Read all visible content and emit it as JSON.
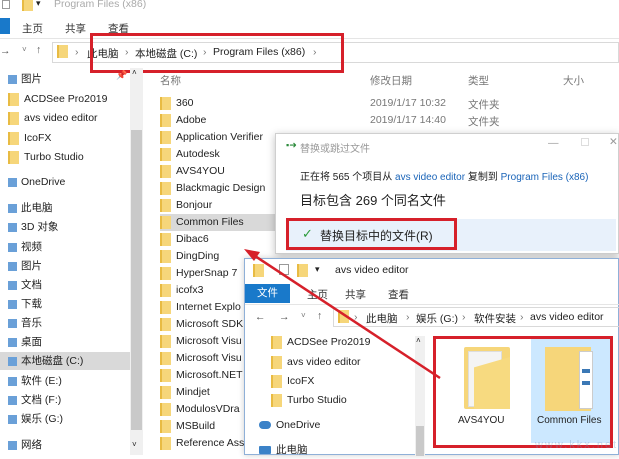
{
  "back_window": {
    "title": "Program Files (x86)",
    "ribbon_tabs": [
      "主页",
      "共享",
      "查看"
    ],
    "breadcrumb": [
      "此电脑",
      "本地磁盘 (C:)",
      "Program Files (x86)"
    ],
    "nav_items": [
      {
        "label": "图片",
        "quick": true
      },
      {
        "label": "ACDSee Pro2019",
        "quick": true
      },
      {
        "label": "avs video editor",
        "quick": true
      },
      {
        "label": "IcoFX",
        "quick": true
      },
      {
        "label": "Turbo Studio",
        "quick": true
      },
      {
        "label": "OneDrive"
      },
      {
        "label": "此电脑"
      },
      {
        "label": "3D 对象"
      },
      {
        "label": "视频"
      },
      {
        "label": "图片"
      },
      {
        "label": "文档"
      },
      {
        "label": "下载"
      },
      {
        "label": "音乐"
      },
      {
        "label": "桌面"
      },
      {
        "label": "本地磁盘 (C:)",
        "selected": true
      },
      {
        "label": "软件 (E:)"
      },
      {
        "label": "文档 (F:)"
      },
      {
        "label": "娱乐 (G:)"
      },
      {
        "label": "网络"
      }
    ],
    "columns": [
      "名称",
      "修改日期",
      "类型",
      "大小"
    ],
    "files": [
      {
        "name": "360",
        "date": "2019/1/17 10:32",
        "type": "文件夹"
      },
      {
        "name": "Adobe",
        "date": "2019/1/17 14:40",
        "type": "文件夹"
      },
      {
        "name": "Application Verifier"
      },
      {
        "name": "Autodesk"
      },
      {
        "name": "AVS4YOU"
      },
      {
        "name": "Blackmagic Design"
      },
      {
        "name": "Bonjour"
      },
      {
        "name": "Common Files",
        "selected": true
      },
      {
        "name": "Dibac6"
      },
      {
        "name": "DingDing"
      },
      {
        "name": "HyperSnap 7"
      },
      {
        "name": "icofx3"
      },
      {
        "name": "Internet Explo"
      },
      {
        "name": "Microsoft SDK"
      },
      {
        "name": "Microsoft Visu"
      },
      {
        "name": "Microsoft Visu"
      },
      {
        "name": "Microsoft.NET"
      },
      {
        "name": "Mindjet"
      },
      {
        "name": "ModulosVDra"
      },
      {
        "name": "MSBuild"
      },
      {
        "name": "Reference Ass"
      }
    ]
  },
  "dialog": {
    "title": "替换或跳过文件",
    "line1_pre": "正在将 565 个项目从 ",
    "line1_src": "avs video editor",
    "line1_mid": " 复制到 ",
    "line1_dst": "Program Files (x86)",
    "line2": "目标包含 269 个同名文件",
    "replace_option": "替换目标中的文件(R)"
  },
  "front_window": {
    "title": "avs video editor",
    "ribbon_tabs": [
      "文件",
      "主页",
      "共享",
      "查看"
    ],
    "breadcrumb": [
      "此电脑",
      "娱乐 (G:)",
      "软件安装",
      "avs video editor"
    ],
    "nav_items": [
      "ACDSee Pro2019",
      "avs video editor",
      "IcoFX",
      "Turbo Studio",
      "OneDrive",
      "此电脑"
    ],
    "folders": [
      {
        "name": "AVS4YOU"
      },
      {
        "name": "Common Files",
        "selected": true
      }
    ]
  },
  "watermark": "www.kkx.net",
  "colors": {
    "accent": "#1979ca",
    "highlight": "#d6202a",
    "selection": "#cce8ff"
  }
}
